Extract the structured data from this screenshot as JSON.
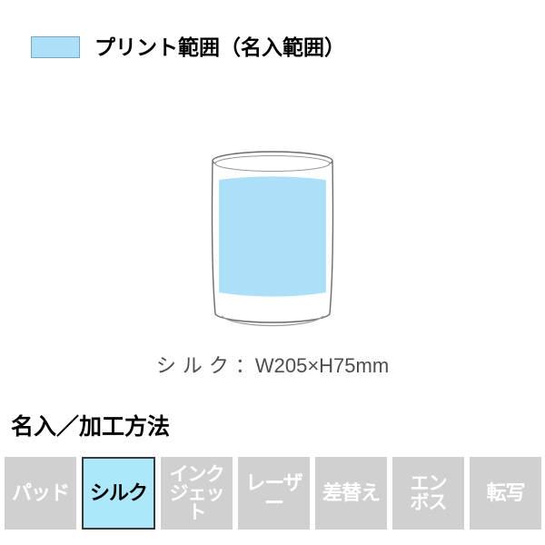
{
  "legend": {
    "swatch_color": "#ace0f8",
    "swatch_border_color": "#7ba7bd",
    "label": "プリント範囲（名入範囲）",
    "swatch_icon": "print-area-swatch"
  },
  "product": {
    "illustration_name": "tumbler-cup-illustration",
    "print_area_color": "#ace0f8",
    "outline_color": "#6b6b6b",
    "dimension": {
      "method_label": "シルク",
      "separator": "：",
      "size": "W205×H75mm",
      "full_text": "シルク：W205×H75mm"
    }
  },
  "section": {
    "heading": "名入／加工方法"
  },
  "methods": {
    "inactive_bg": "#d0d0d0",
    "inactive_text_color": "#ffffff",
    "active_bg": "#ace7fa",
    "active_text_color": "#000000",
    "active_border_color": "#3a3a3a",
    "items": [
      {
        "label": "パッド",
        "active": false,
        "lines": 1
      },
      {
        "label": "シルク",
        "active": true,
        "lines": 1
      },
      {
        "label": "インク\nジェット",
        "active": false,
        "lines": 2
      },
      {
        "label": "レーザー",
        "active": false,
        "lines": 1
      },
      {
        "label": "差替え",
        "active": false,
        "lines": 1
      },
      {
        "label": "エン\nボス",
        "active": false,
        "lines": 2
      },
      {
        "label": "転写",
        "active": false,
        "lines": 1
      }
    ]
  }
}
